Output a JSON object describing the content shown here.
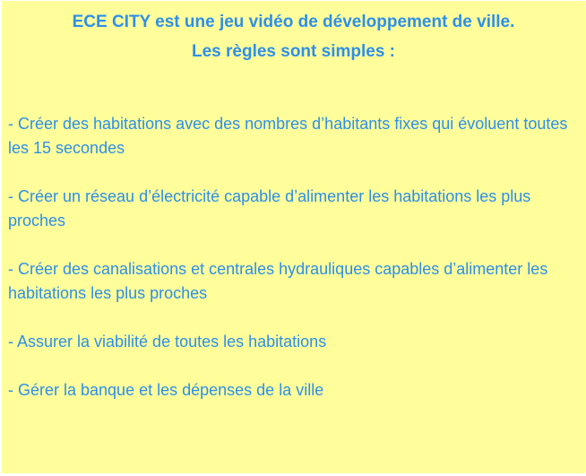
{
  "intro": {
    "line_1": "ECE CITY est une jeu vidéo de développement de ville.",
    "line_2": "Les règles sont simples :"
  },
  "rules": [
    "- Créer des habitations avec des nombres d’habitants fixes qui évoluent toutes les 15 secondes",
    "- Créer un réseau d’électricité capable d’alimenter les habitations les plus proches",
    "- Créer des canalisations et centrales hydrauliques capables d’alimenter les habitations les plus proches",
    "- Assurer la viabilité de toutes les habitations",
    "- Gérer la banque et les dépenses de la ville"
  ],
  "colors": {
    "background": "#fffe9b",
    "text": "#2e8fe8"
  }
}
